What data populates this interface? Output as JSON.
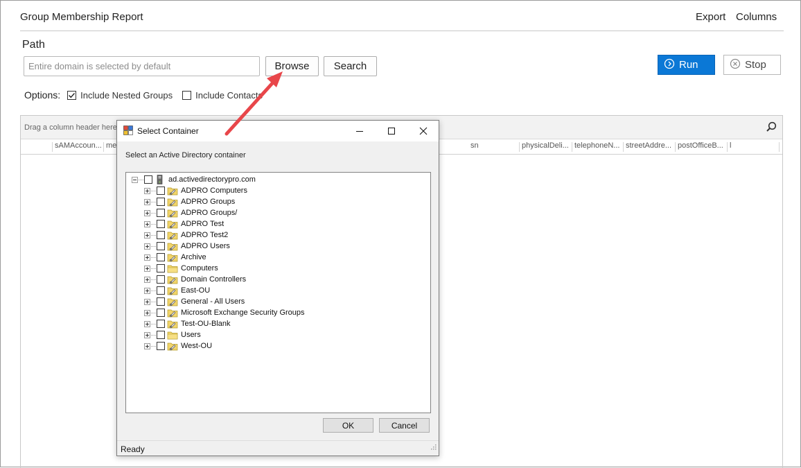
{
  "app": {
    "title": "Group Membership Report"
  },
  "header": {
    "export_label": "Export",
    "columns_label": "Columns"
  },
  "path": {
    "label": "Path",
    "placeholder": "Entire domain is selected by default",
    "browse_label": "Browse",
    "search_label": "Search"
  },
  "actions": {
    "run_label": "Run",
    "stop_label": "Stop",
    "run_color": "#0b78d6"
  },
  "options": {
    "label": "Options:",
    "include_nested_groups": {
      "label": "Include Nested Groups",
      "checked": true
    },
    "include_contacts": {
      "label": "Include Contacts",
      "checked": false
    }
  },
  "grid": {
    "group_hint": "Drag a column header here",
    "columns": [
      "sAMAccoun...",
      "me",
      "sn",
      "physicalDeli...",
      "telephoneN...",
      "streetAddre...",
      "postOfficeB...",
      "l"
    ]
  },
  "dialog": {
    "title": "Select Container",
    "prompt": "Select an Active Directory container",
    "root": "ad.activedirectorypro.com",
    "items": [
      {
        "label": "ADPRO Computers",
        "icon": "ou-icon"
      },
      {
        "label": "ADPRO Groups",
        "icon": "ou-icon"
      },
      {
        "label": "ADPRO Groups/",
        "icon": "ou-icon"
      },
      {
        "label": "ADPRO Test",
        "icon": "ou-icon"
      },
      {
        "label": "ADPRO Test2",
        "icon": "ou-icon"
      },
      {
        "label": "ADPRO Users",
        "icon": "ou-icon"
      },
      {
        "label": "Archive",
        "icon": "ou-icon"
      },
      {
        "label": "Computers",
        "icon": "folder-icon"
      },
      {
        "label": "Domain Controllers",
        "icon": "ou-icon"
      },
      {
        "label": "East-OU",
        "icon": "ou-icon"
      },
      {
        "label": "General - All Users",
        "icon": "ou-icon"
      },
      {
        "label": "Microsoft Exchange Security Groups",
        "icon": "ou-icon"
      },
      {
        "label": "Test-OU-Blank",
        "icon": "ou-icon"
      },
      {
        "label": "Users",
        "icon": "folder-icon"
      },
      {
        "label": "West-OU",
        "icon": "ou-icon"
      }
    ],
    "ok_label": "OK",
    "cancel_label": "Cancel",
    "status": "Ready"
  }
}
